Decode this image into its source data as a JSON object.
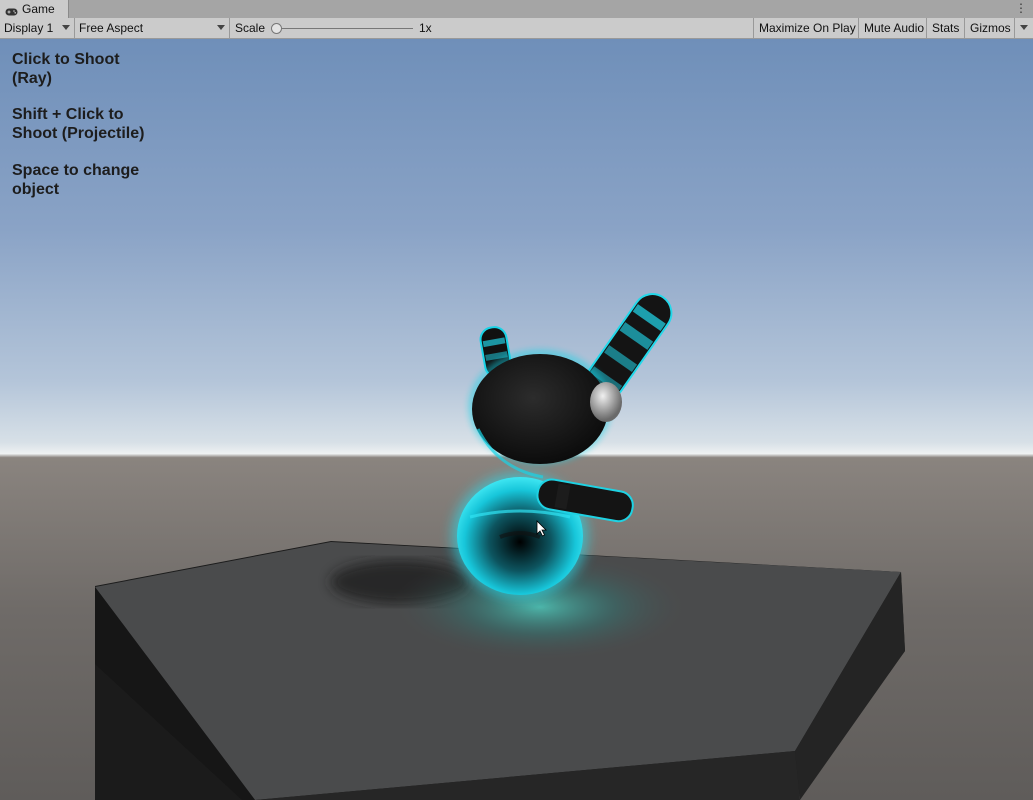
{
  "tab": {
    "title": "Game",
    "icon": "gamepad-icon",
    "menu_glyph": "⋮"
  },
  "toolbar": {
    "display_label": "Display 1",
    "aspect_label": "Free Aspect",
    "scale_label": "Scale",
    "scale_value": "1x",
    "maximize_label": "Maximize On Play",
    "mute_label": "Mute Audio",
    "stats_label": "Stats",
    "gizmos_label": "Gizmos"
  },
  "hints": {
    "line1": "Click to Shoot\n(Ray)",
    "line2": "Shift + Click to\nShoot (Projectile)",
    "line3": "Space to change\nobject"
  },
  "colors": {
    "glow": "#19d3e6",
    "body": "#1a1a1a",
    "platform_top": "#4a4b4c",
    "platform_side": "#1c1c1c"
  }
}
